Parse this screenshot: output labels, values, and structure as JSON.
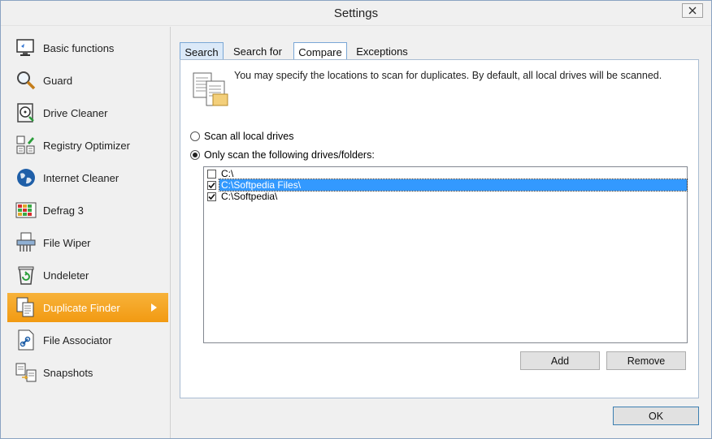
{
  "window": {
    "title": "Settings"
  },
  "sidebar": {
    "items": [
      {
        "label": "Basic functions",
        "icon": "monitor-icon"
      },
      {
        "label": "Guard",
        "icon": "magnifier-icon"
      },
      {
        "label": "Drive Cleaner",
        "icon": "disk-icon"
      },
      {
        "label": "Registry Optimizer",
        "icon": "registry-icon"
      },
      {
        "label": "Internet Cleaner",
        "icon": "globe-icon"
      },
      {
        "label": "Defrag 3",
        "icon": "defrag-grid-icon"
      },
      {
        "label": "File Wiper",
        "icon": "shredder-icon"
      },
      {
        "label": "Undeleter",
        "icon": "recycle-bin-icon"
      },
      {
        "label": "Duplicate Finder",
        "icon": "duplicate-documents-icon",
        "active": true
      },
      {
        "label": "File Associator",
        "icon": "file-link-icon"
      },
      {
        "label": "Snapshots",
        "icon": "snapshot-compare-icon"
      }
    ]
  },
  "tabs": [
    {
      "label": "Search",
      "active": true
    },
    {
      "label": "Search for"
    },
    {
      "label": "Compare"
    },
    {
      "label": "Exceptions"
    }
  ],
  "content": {
    "description": "You may specify the locations to scan for duplicates. By default, all local drives will be scanned.",
    "radio_all": "Scan all local drives",
    "radio_only": "Only scan the following drives/folders:",
    "selected_option": "only",
    "folders": [
      {
        "path": "C:\\",
        "checked": false,
        "selected": false
      },
      {
        "path": "C:\\Softpedia Files\\",
        "checked": true,
        "selected": true
      },
      {
        "path": "C:\\Softpedia\\",
        "checked": true,
        "selected": false
      }
    ],
    "add_label": "Add",
    "remove_label": "Remove"
  },
  "footer": {
    "ok_label": "OK"
  },
  "colors": {
    "accent": "#f29a12",
    "selection": "#3399ff",
    "tab_border": "#7aa7d6"
  }
}
